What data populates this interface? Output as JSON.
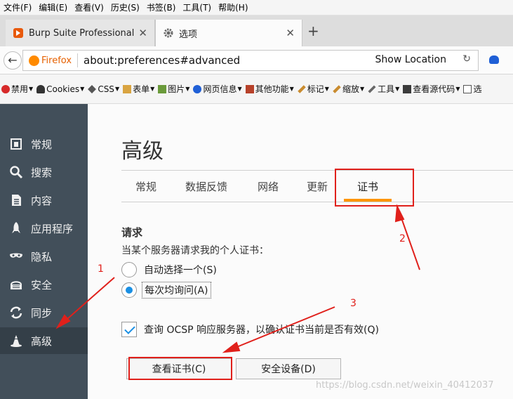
{
  "menubar": [
    "文件(F)",
    "编辑(E)",
    "查看(V)",
    "历史(S)",
    "书签(B)",
    "工具(T)",
    "帮助(H)"
  ],
  "tabs": [
    {
      "title": "Burp Suite Professional"
    },
    {
      "title": "选项"
    }
  ],
  "nav": {
    "brand": "Firefox",
    "url": "about:preferences#advanced",
    "show_location": "Show Location"
  },
  "toolbar": [
    "禁用",
    "Cookies",
    "CSS",
    "表单",
    "图片",
    "网页信息",
    "其他功能",
    "标记",
    "缩放",
    "工具",
    "查看源代码",
    "选"
  ],
  "sidebar": {
    "items": [
      {
        "label": "常规",
        "icon": "general-icon"
      },
      {
        "label": "搜索",
        "icon": "search-icon"
      },
      {
        "label": "内容",
        "icon": "content-icon"
      },
      {
        "label": "应用程序",
        "icon": "applications-icon"
      },
      {
        "label": "隐私",
        "icon": "privacy-mask-icon"
      },
      {
        "label": "安全",
        "icon": "security-icon"
      },
      {
        "label": "同步",
        "icon": "sync-icon"
      },
      {
        "label": "高级",
        "icon": "advanced-icon"
      }
    ],
    "active_index": 7
  },
  "content": {
    "title": "高级",
    "subtabs": [
      "常规",
      "数据反馈",
      "网络",
      "更新",
      "证书"
    ],
    "active_subtab": 4,
    "section_title": "请求",
    "section_desc": "当某个服务器请求我的个人证书：",
    "radios": [
      {
        "label": "自动选择一个(S)",
        "checked": false
      },
      {
        "label": "每次均询问(A)",
        "checked": true
      }
    ],
    "ocsp": {
      "label": "查询 OCSP 响应服务器，以确认证书当前是否有效(Q)",
      "checked": true
    },
    "buttons": {
      "view_certs": "查看证书(C)",
      "security_devices": "安全设备(D)"
    }
  },
  "annotations": {
    "n1": "1",
    "n2": "2",
    "n3": "3",
    "color": "#e0201b"
  },
  "watermark": "https://blog.csdn.net/weixin_40412037",
  "colors": {
    "sidebar": "#424f5a",
    "sidebar_active": "#343f48",
    "accent": "#ff9500",
    "check": "#1a8fe3"
  }
}
